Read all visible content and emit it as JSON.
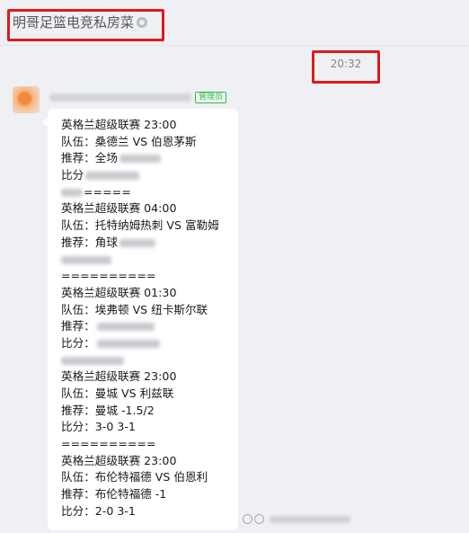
{
  "header": {
    "group_name": "明哥足篮电竞私房菜"
  },
  "timestamp": "20:32",
  "sender": {
    "role_badge": "管理员"
  },
  "message": {
    "l1": "英格兰超级联赛  23:00",
    "l2": "队伍：桑德兰 VS 伯恩茅斯",
    "l3": "推荐：全场",
    "l4": "比分",
    "l5": "=====",
    "l6": "英格兰超级联赛  04:00",
    "l7": "队伍：托特纳姆热刺 VS 富勒姆",
    "l8": "推荐：角球",
    "l9": "",
    "l10": "==========",
    "l11": "英格兰超级联赛  01:30",
    "l12": "队伍：埃弗顿 VS 纽卡斯尔联",
    "l13": "推荐：",
    "l14": "比分：",
    "l15": "",
    "l16": "英格兰超级联赛  23:00",
    "l17": "队伍：曼城 VS 利兹联",
    "l18": "推荐：曼城 -1.5/2",
    "l19": "比分：3-0 3-1",
    "l20": "==========",
    "l21": "英格兰超级联赛  23:00",
    "l22": "队伍：布伦特福德 VS 伯恩利",
    "l23": "推荐：布伦特福德 -1",
    "l24": "比分：2-0 3-1"
  }
}
